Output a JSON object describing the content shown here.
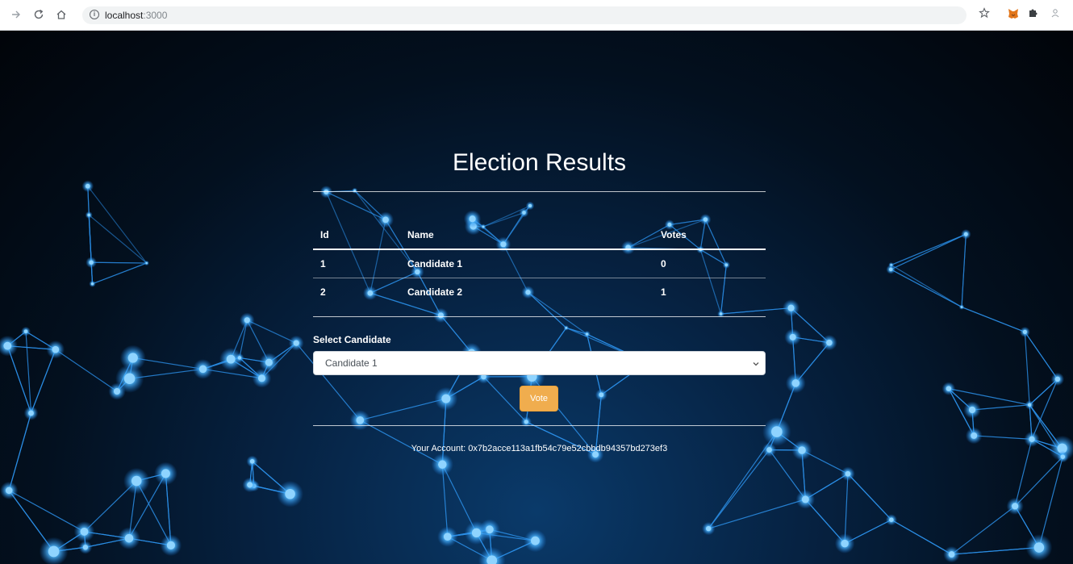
{
  "browser": {
    "url_host": "localhost",
    "url_port": ":3000",
    "icons": [
      "forward-arrow-icon",
      "reload-icon",
      "home-icon",
      "info-icon",
      "star-icon",
      "metamask-fox-icon",
      "puzzle-extension-icon",
      "profile-icon"
    ]
  },
  "page": {
    "title": "Election Results",
    "table": {
      "headers": [
        "Id",
        "Name",
        "Votes"
      ],
      "rows": [
        {
          "id": "1",
          "name": "Candidate 1",
          "votes": "0"
        },
        {
          "id": "2",
          "name": "Candidate 2",
          "votes": "1"
        }
      ]
    },
    "select_label": "Select Candidate",
    "selected_candidate": "Candidate 1",
    "vote_button": "Vote",
    "account": "Your Account: 0x7b2acce113a1fb54c79e52cbbdb94357bd273ef3"
  },
  "colors": {
    "accent_button": "#f0ad4e",
    "background_dark": "#03101f",
    "network_glow": "#2a9df4"
  }
}
